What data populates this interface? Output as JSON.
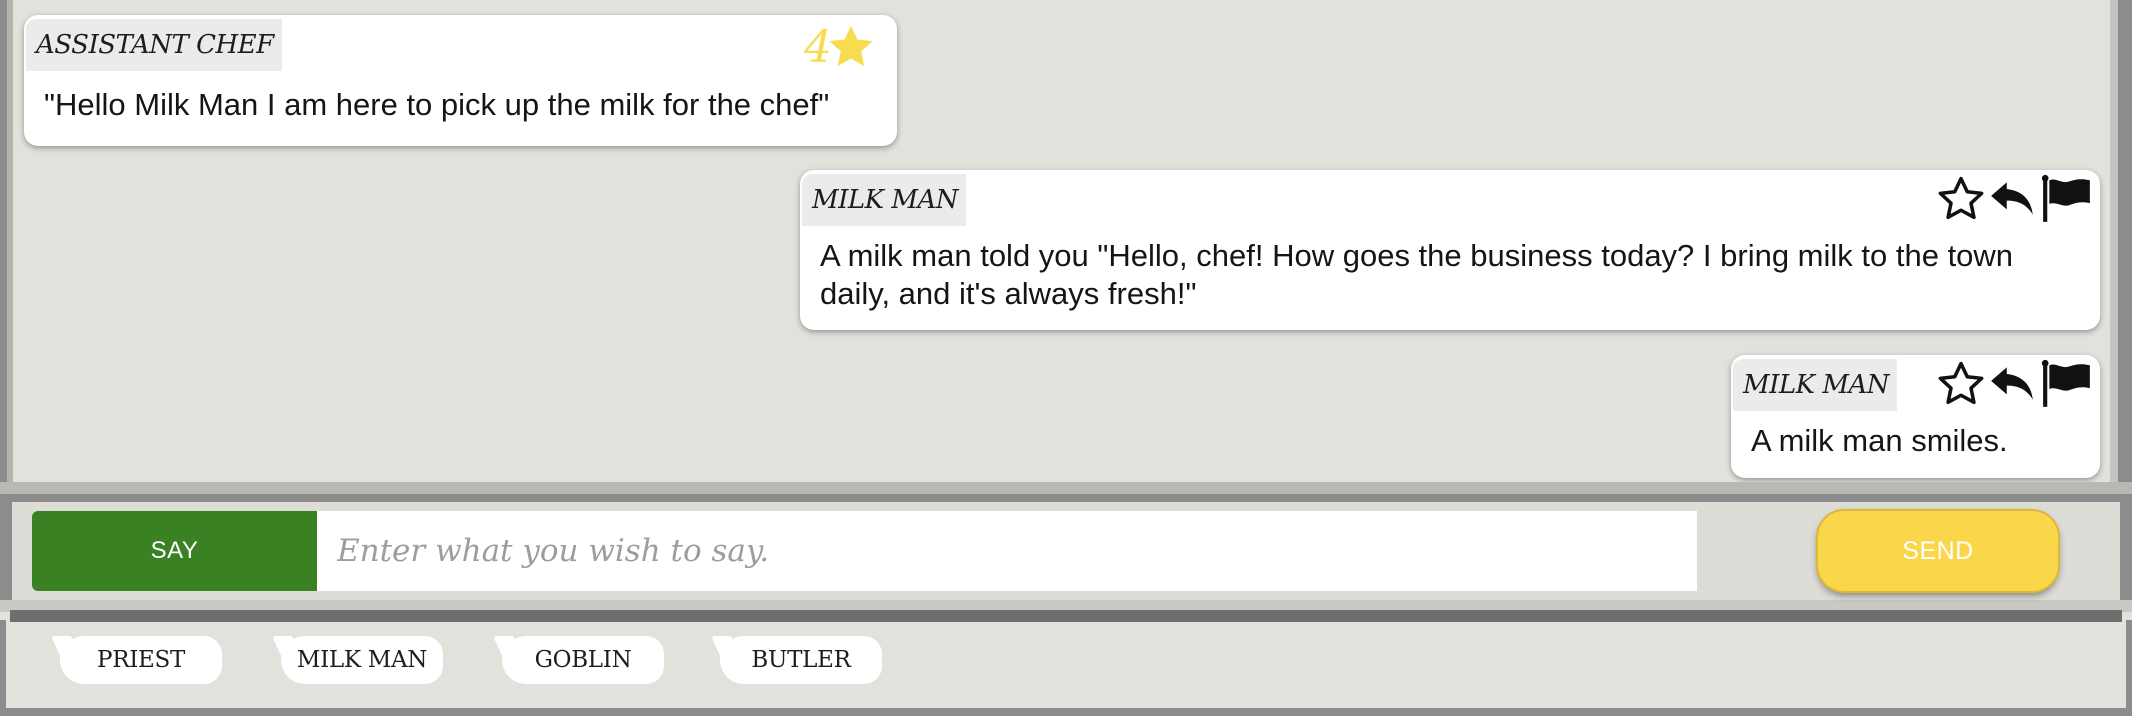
{
  "messages": [
    {
      "speaker": "ASSISTANT CHEF",
      "text": "\"Hello Milk Man I am here to pick up the milk for the chef\"",
      "rating": "4"
    },
    {
      "speaker": "MILK MAN",
      "text": "A milk man told you \"Hello, chef! How goes the business today? I bring milk to the town daily, and it's always fresh!\""
    },
    {
      "speaker": "MILK MAN",
      "text": "A milk man smiles."
    }
  ],
  "input": {
    "mode_label": "SAY",
    "placeholder": "Enter what you wish to say.",
    "value": "",
    "send_label": "SEND"
  },
  "characters": [
    "PRIEST",
    "MILK MAN",
    "GOBLIN",
    "BUTLER"
  ],
  "colors": {
    "background": "#e2e1dc",
    "say_button": "#3a8124",
    "send_button": "#fad74a",
    "rating_star": "#f7dc52"
  },
  "icons": {
    "rating": "star-filled-icon",
    "favorite": "star-outline-icon",
    "reply": "reply-arrow-icon",
    "report": "flag-icon"
  }
}
